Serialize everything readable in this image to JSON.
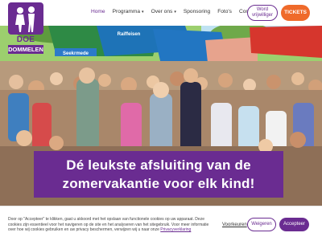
{
  "brand": {
    "logo_line1": "DOE WEEK",
    "logo_line2": "DOMMELEN",
    "primary_color": "#6a2c91",
    "accent_color": "#ef6a2a"
  },
  "nav": {
    "items": [
      {
        "label": "Home",
        "active": true
      },
      {
        "label": "Programma",
        "dropdown": true
      },
      {
        "label": "Over ons",
        "dropdown": true
      },
      {
        "label": "Sponsoring"
      },
      {
        "label": "Foto's"
      },
      {
        "label": "Contact"
      }
    ],
    "caret": "▾",
    "volunteer_line1": "Word",
    "volunteer_line2": "vrijwilliger",
    "tickets_label": "TICKETS"
  },
  "hero": {
    "headline_line1": "Dé leukste afsluiting van de",
    "headline_line2": "zomervakantie voor elk kind!",
    "tent_text_1": "Seekrmede",
    "tent_text_2": "Raiffeisen"
  },
  "cookie": {
    "text_part1": "Door op \"Accepteer\" te klikken, gaat u akkoord met het opslaan van functionele cookies op uw apparaat. Deze cookies zijn essentieel voor het navigeren op de site en het analyseren van het sitegebruik. Voor meer informatie over hoe wij cookies gebruiken en uw privacy beschermen, verwijzen wij u naar onze",
    "privacy_link": "Privacyverklaring",
    "preferences_label": "Voorkeuren",
    "refuse_label": "Weigeren",
    "accept_label": "Accepteer"
  }
}
